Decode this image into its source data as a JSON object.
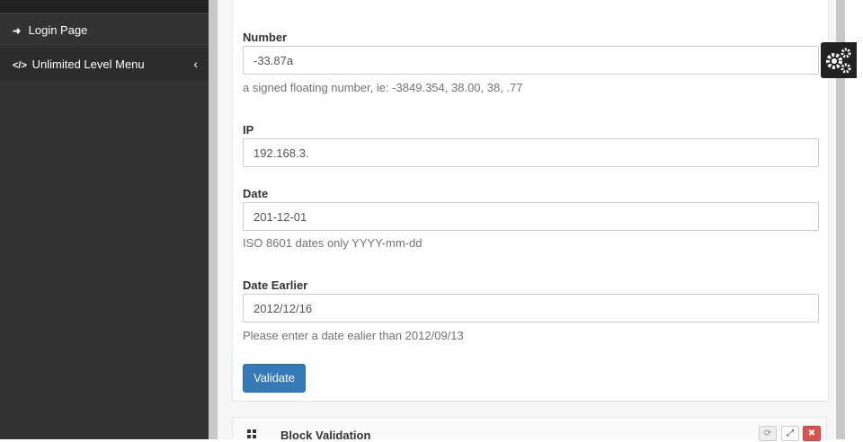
{
  "sidebar": {
    "items": [
      {
        "label": "Login Page",
        "icon": "sign-in-icon"
      },
      {
        "label": "Unlimited Level Menu",
        "icon": "code-icon"
      }
    ]
  },
  "form": {
    "number": {
      "label": "Number",
      "value": "-33.87a",
      "help": "a signed floating number, ie: -3849.354, 38.00, 38, .77"
    },
    "ip": {
      "label": "IP",
      "value": "192.168.3."
    },
    "date": {
      "label": "Date",
      "value": "201-12-01",
      "help": "ISO 8601 dates only YYYY-mm-dd"
    },
    "date_earlier": {
      "label": "Date Earlier",
      "value": "2012/12/16",
      "help": "Please enter a date ealier than 2012/09/13"
    },
    "validate_label": "Validate"
  },
  "block": {
    "title": "Block Validation",
    "close_glyph": "✖",
    "expand_glyph": "⤢",
    "refresh_glyph": "⟳"
  },
  "colors": {
    "primary": "#337ab7",
    "danger": "#d9534f",
    "sidebar": "#333333"
  }
}
